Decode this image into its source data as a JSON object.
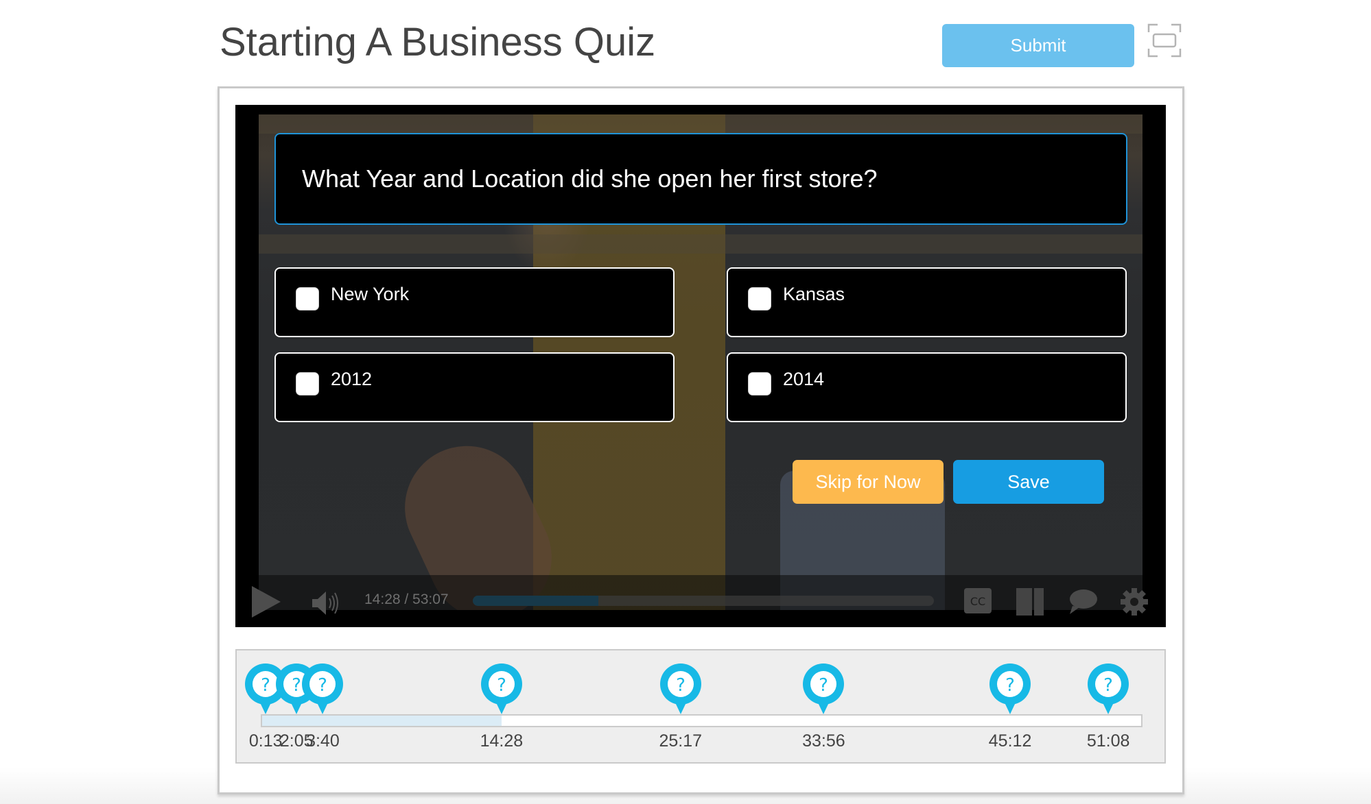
{
  "header": {
    "title": "Starting A Business Quiz",
    "submit_label": "Submit",
    "fullscreen_icon": "fullscreen-icon"
  },
  "quiz": {
    "question": "What Year and Location did she open her first store?",
    "options": [
      {
        "label": "New York",
        "checked": false
      },
      {
        "label": "Kansas",
        "checked": false
      },
      {
        "label": "2012",
        "checked": false
      },
      {
        "label": "2014",
        "checked": false
      }
    ],
    "skip_label": "Skip for Now",
    "save_label": "Save",
    "colors": {
      "question_border": "#1f93d8",
      "skip": "#FDB94E",
      "save": "#179DE2",
      "submit": "#6BC1EE",
      "marker": "#17B9E6"
    }
  },
  "player": {
    "current_time": "14:28",
    "duration": "53:07",
    "time_readout": "14:28 / 53:07",
    "progress_seconds": 868,
    "duration_seconds": 3187,
    "icons": [
      "play-icon",
      "volume-icon",
      "cc-icon",
      "columns-icon",
      "chat-icon",
      "gear-icon"
    ],
    "cc_text": "CC"
  },
  "timeline": {
    "duration_seconds": 3187,
    "played_seconds": 868,
    "markers": [
      {
        "label": "0:13",
        "seconds": 13
      },
      {
        "label": "2:05",
        "seconds": 125
      },
      {
        "label": "3:40",
        "seconds": 220
      },
      {
        "label": "14:28",
        "seconds": 868
      },
      {
        "label": "25:17",
        "seconds": 1517
      },
      {
        "label": "33:56",
        "seconds": 2036
      },
      {
        "label": "45:12",
        "seconds": 2712
      },
      {
        "label": "51:08",
        "seconds": 3068
      }
    ]
  }
}
